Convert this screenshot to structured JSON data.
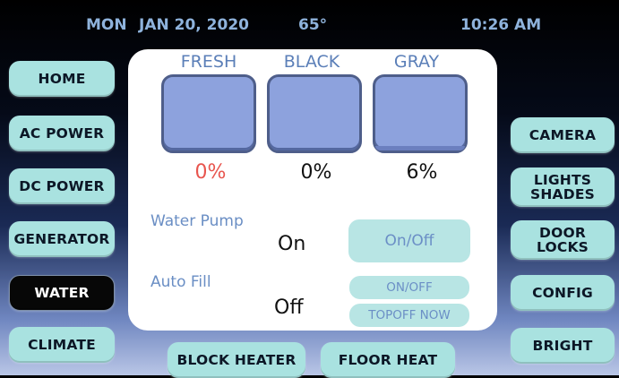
{
  "status_bar": {
    "day": "MON",
    "date": "JAN 20, 2020",
    "temp": "65°",
    "time": "10:26 AM"
  },
  "left_nav": [
    {
      "label": "HOME",
      "active": false
    },
    {
      "label": "AC POWER",
      "active": false
    },
    {
      "label": "DC POWER",
      "active": false
    },
    {
      "label": "GENERATOR",
      "active": false
    },
    {
      "label": "WATER",
      "active": true
    },
    {
      "label": "CLIMATE",
      "active": false
    }
  ],
  "right_nav": [
    {
      "label": "CAMERA"
    },
    {
      "label": "LIGHTS\nSHADES"
    },
    {
      "label": "DOOR\nLOCKS"
    },
    {
      "label": "CONFIG"
    },
    {
      "label": "BRIGHT"
    }
  ],
  "bottom_nav": [
    {
      "label": "BLOCK HEATER"
    },
    {
      "label": "FLOOR HEAT"
    }
  ],
  "tanks": [
    {
      "name": "FRESH",
      "percent": "0%",
      "level": 0,
      "color": "#e8554e"
    },
    {
      "name": "BLACK",
      "percent": "0%",
      "level": 0,
      "color": "#111111"
    },
    {
      "name": "GRAY",
      "percent": "6%",
      "level": 6,
      "color": "#111111"
    }
  ],
  "water_pump": {
    "label": "Water Pump",
    "value": "On",
    "button": "On/Off"
  },
  "auto_fill": {
    "label": "Auto Fill",
    "value": "Off",
    "button_onoff": "ON/OFF",
    "button_topoff": "TOPOFF NOW"
  },
  "colors": {
    "accent": "#a9e2e0",
    "active_bg": "#070707",
    "panel": "#ffffff",
    "tank": "#8da2dd",
    "label_blue": "#6a8ec4"
  }
}
